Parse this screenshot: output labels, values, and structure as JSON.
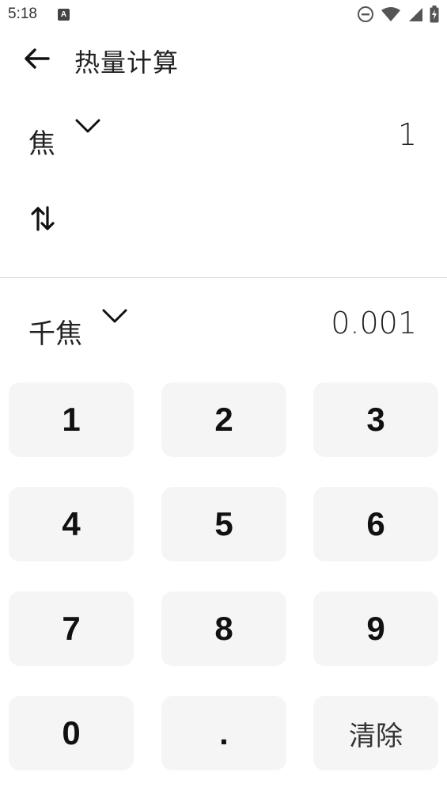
{
  "status_bar": {
    "time": "5:18",
    "notification_badge": "A",
    "icons": [
      "do-not-disturb-icon",
      "wifi-icon",
      "cell-signal-icon",
      "battery-charging-icon"
    ]
  },
  "app_bar": {
    "title": "热量计算",
    "back_icon": "arrow-left-icon"
  },
  "converter": {
    "from_unit": "焦",
    "from_value": "1",
    "swap_icon": "swap-vertical-icon",
    "to_unit": "千焦",
    "to_value": "0.001"
  },
  "keypad": {
    "keys": [
      "1",
      "2",
      "3",
      "4",
      "5",
      "6",
      "7",
      "8",
      "9",
      "0",
      ".",
      "清除"
    ]
  },
  "colors": {
    "background": "#ffffff",
    "key_background": "#f5f5f5",
    "text": "#111111",
    "divider": "#e0e0e0"
  }
}
